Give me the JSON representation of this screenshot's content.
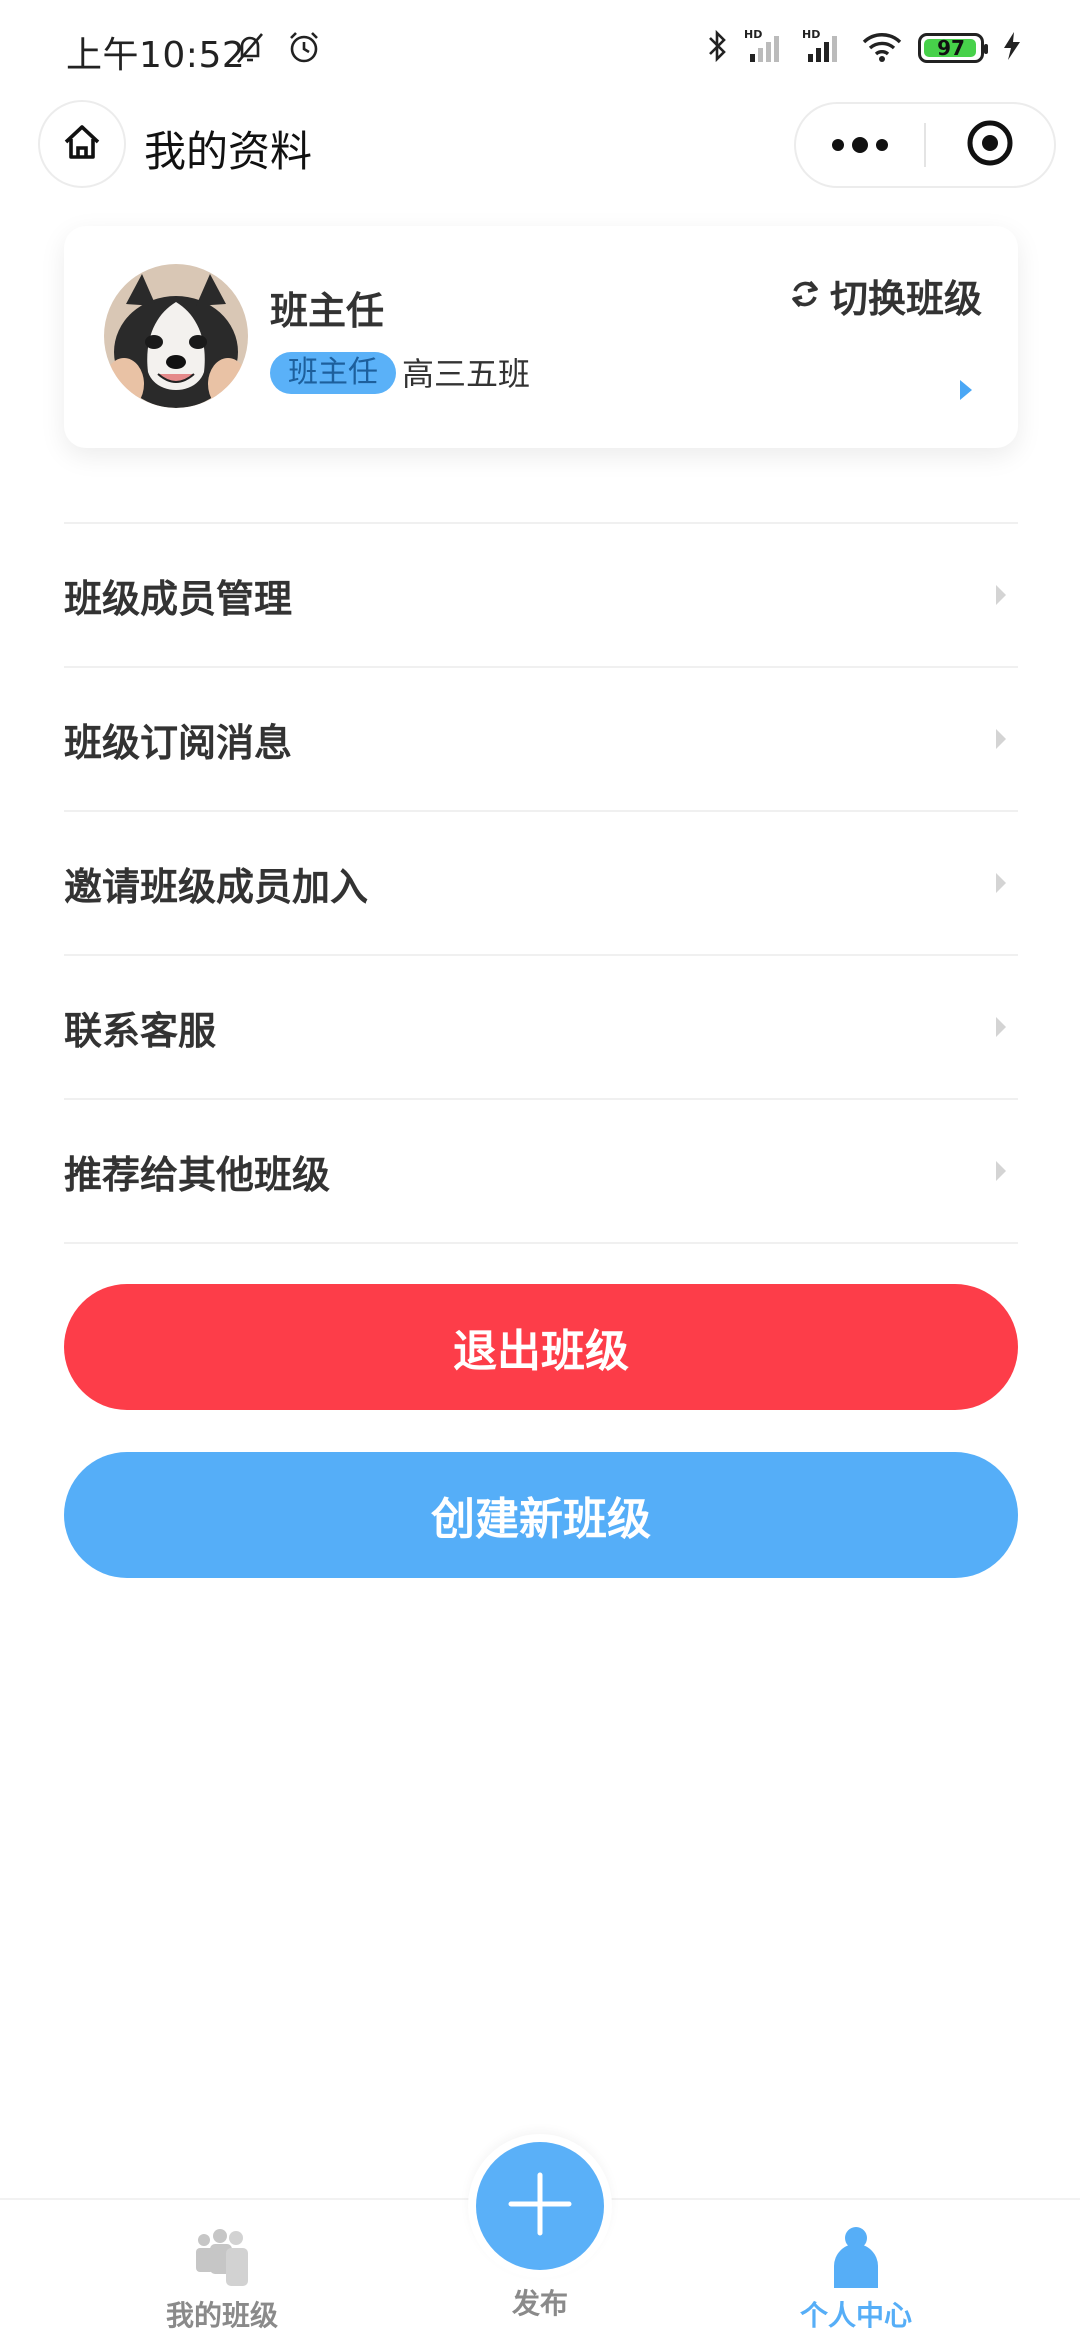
{
  "status_bar": {
    "time": "上午10:52",
    "battery": "97",
    "icons": [
      "mute-bell-icon",
      "alarm-icon",
      "bluetooth-icon",
      "signal-hd-icon",
      "signal-hd-icon",
      "wifi-icon",
      "battery-icon",
      "charging-icon"
    ]
  },
  "nav": {
    "title": "我的资料",
    "home_icon": "home-icon",
    "more_icon": "more-icon",
    "close_icon": "target-icon"
  },
  "profile": {
    "name": "班主任",
    "role_badge": "班主任",
    "class_name": "高三五班",
    "switch_label": "切换班级",
    "colors": {
      "badge_bg": "#5ab1f8",
      "arrow": "#4aa7f5"
    }
  },
  "menu": {
    "items": [
      {
        "label": "班级成员管理"
      },
      {
        "label": "班级订阅消息"
      },
      {
        "label": "邀请班级成员加入"
      },
      {
        "label": "联系客服"
      },
      {
        "label": "推荐给其他班级"
      }
    ]
  },
  "buttons": {
    "exit": "退出班级",
    "create": "创建新班级",
    "colors": {
      "exit": "#fd3d49",
      "create": "#55aef8"
    }
  },
  "tab_bar": {
    "items": [
      {
        "label": "我的班级",
        "icon": "group-icon",
        "active": false
      },
      {
        "label": "发布",
        "icon": "plus-icon",
        "active": false
      },
      {
        "label": "个人中心",
        "icon": "person-icon",
        "active": true
      }
    ],
    "active_color": "#56aef7"
  }
}
